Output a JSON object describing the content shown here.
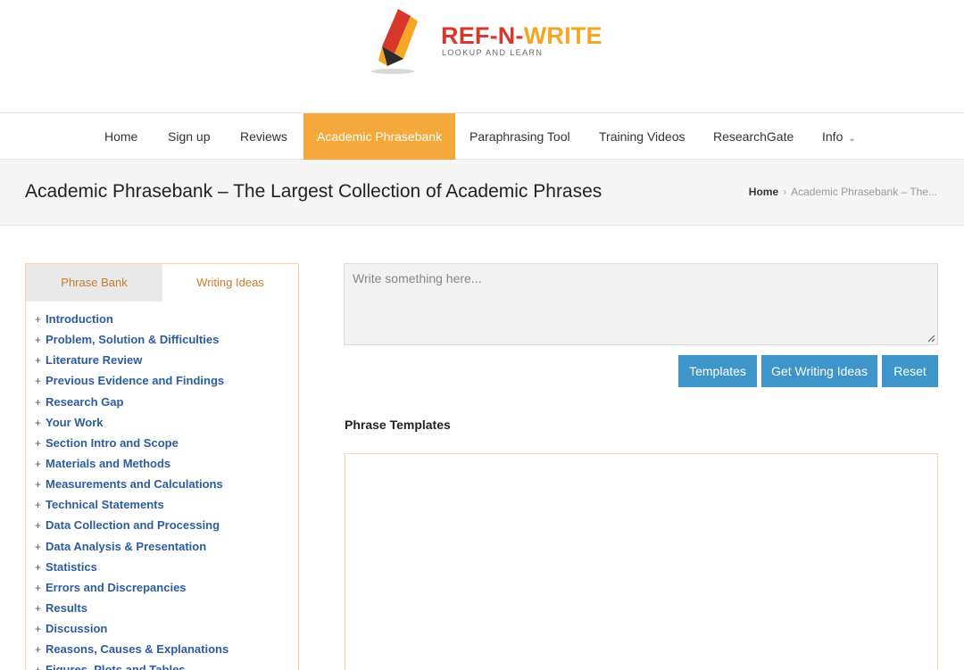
{
  "logo": {
    "title_part1": "REF-N-",
    "title_part2": "WRITE",
    "subtitle": "LOOKUP AND LEARN",
    "colors": {
      "red": "#d9372b",
      "orange": "#f5a623"
    }
  },
  "nav": {
    "items": [
      {
        "label": "Home"
      },
      {
        "label": "Sign up"
      },
      {
        "label": "Reviews"
      },
      {
        "label": "Academic Phrasebank",
        "active": true
      },
      {
        "label": "Paraphrasing Tool"
      },
      {
        "label": "Training Videos"
      },
      {
        "label": "ResearchGate"
      },
      {
        "label": "Info",
        "has_dropdown": true
      }
    ],
    "active_color": "#f4a93a"
  },
  "page": {
    "title": "Academic Phrasebank – The Largest Collection of Academic Phrases",
    "breadcrumb_home": "Home",
    "breadcrumb_sep": "›",
    "breadcrumb_current": "Academic Phrasebank – The..."
  },
  "sidebar": {
    "tabs": [
      {
        "label": "Phrase Bank",
        "active": true
      },
      {
        "label": "Writing Ideas"
      }
    ],
    "topics": [
      "Introduction",
      "Problem, Solution & Difficulties",
      "Literature Review",
      "Previous Evidence and Findings",
      "Research Gap",
      "Your Work",
      "Section Intro and Scope",
      "Materials and Methods",
      "Measurements and Calculations",
      "Technical Statements",
      "Data Collection and Processing",
      "Data Analysis & Presentation",
      "Statistics",
      "Errors and Discrepancies",
      "Results",
      "Discussion",
      "Reasons, Causes & Explanations",
      "Figures, Plots and Tables"
    ],
    "plus_symbol": "+"
  },
  "editor": {
    "placeholder": "Write something here...",
    "value": ""
  },
  "buttons": {
    "templates": "Templates",
    "writing_ideas": "Get Writing Ideas",
    "reset": "Reset",
    "color": "#3e95c9"
  },
  "results": {
    "heading": "Phrase Templates"
  }
}
